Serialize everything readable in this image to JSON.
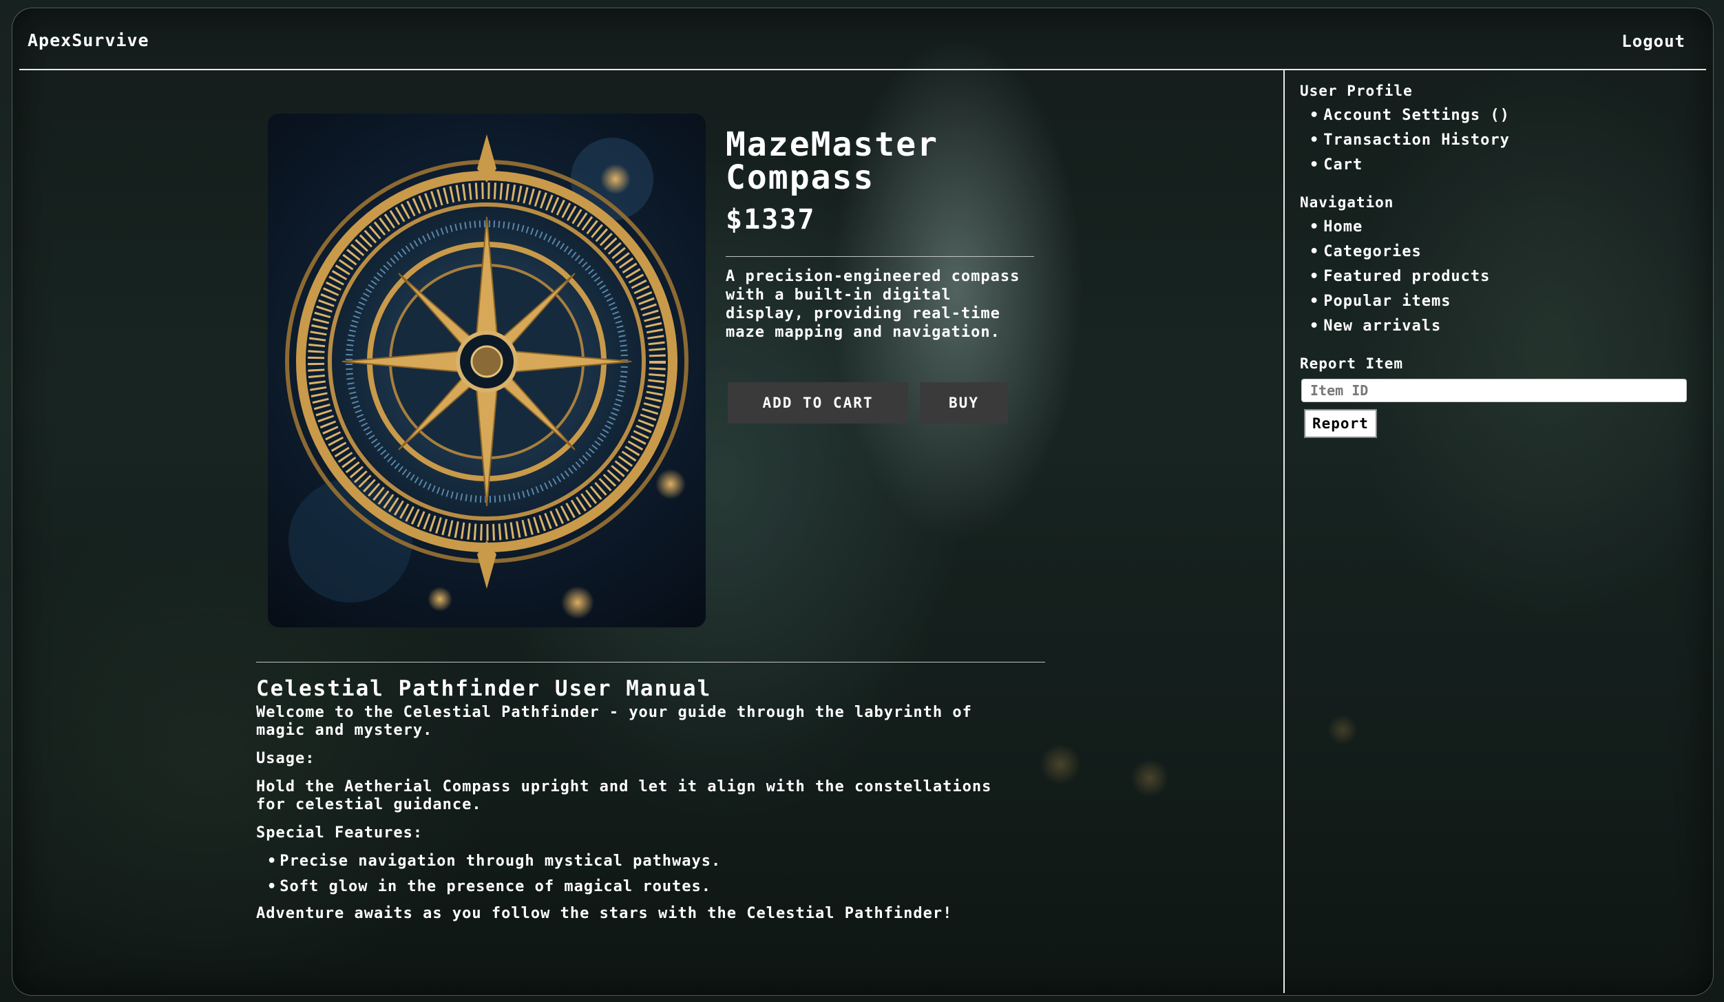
{
  "header": {
    "brand": "ApexSurvive",
    "logout_label": "Logout"
  },
  "product": {
    "image_icon": "compass-image",
    "title": "MazeMaster Compass",
    "price": "$1337",
    "description": "A precision-engineered compass with a built-in digital display, providing real-time maze mapping and navigation.",
    "add_to_cart_label": "ADD TO CART",
    "buy_label": "BUY"
  },
  "manual": {
    "title": "Celestial Pathfinder User Manual",
    "intro": "Welcome to the Celestial Pathfinder - your guide through the labyrinth of magic and mystery.",
    "usage_heading": "Usage:",
    "usage_text": "Hold the Aetherial Compass upright and let it align with the constellations for celestial guidance.",
    "features_heading": "Special Features:",
    "features": [
      "Precise navigation through mystical pathways.",
      "Soft glow in the presence of magical routes."
    ],
    "closing": "Adventure awaits as you follow the stars with the Celestial Pathfinder!"
  },
  "sidebar": {
    "profile_heading": "User Profile",
    "profile_items": [
      "Account Settings ()",
      "Transaction History",
      "Cart"
    ],
    "navigation_heading": "Navigation",
    "navigation_items": [
      "Home",
      "Categories",
      "Featured products",
      "Popular items",
      "New arrivals"
    ],
    "report_heading": "Report Item",
    "report_placeholder": "Item ID",
    "report_button_label": "Report"
  },
  "colors": {
    "button_bg": "#3a3a3a",
    "text": "#ffffff",
    "gold": "#c89a4a"
  }
}
